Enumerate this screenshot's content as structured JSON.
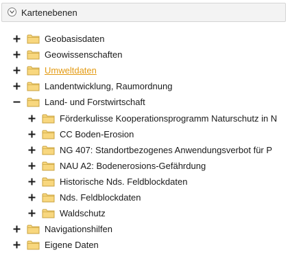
{
  "panel": {
    "title": "Kartenebenen",
    "collapse_icon": "chevron-down-icon"
  },
  "colors": {
    "folder_fill": "#f8d77e",
    "folder_stroke": "#c9a23d",
    "highlight_text": "#e39a12",
    "expander": "#1a1a1a"
  },
  "tree": [
    {
      "label": "Geobasisdaten",
      "level": 0,
      "expander": "plus",
      "highlighted": false
    },
    {
      "label": "Geowissenschaften",
      "level": 0,
      "expander": "plus",
      "highlighted": false
    },
    {
      "label": "Umweltdaten",
      "level": 0,
      "expander": "plus",
      "highlighted": true
    },
    {
      "label": "Landentwicklung, Raumordnung",
      "level": 0,
      "expander": "plus",
      "highlighted": false
    },
    {
      "label": "Land- und Forstwirtschaft",
      "level": 0,
      "expander": "minus",
      "highlighted": false
    },
    {
      "label": "Förderkulisse Kooperationsprogramm Naturschutz in N",
      "level": 1,
      "expander": "plus",
      "highlighted": false
    },
    {
      "label": "CC Boden-Erosion",
      "level": 1,
      "expander": "plus",
      "highlighted": false
    },
    {
      "label": "NG 407: Standortbezogenes Anwendungsverbot für P",
      "level": 1,
      "expander": "plus",
      "highlighted": false
    },
    {
      "label": "NAU A2: Bodenerosions-Gefährdung",
      "level": 1,
      "expander": "plus",
      "highlighted": false
    },
    {
      "label": "Historische Nds. Feldblockdaten",
      "level": 1,
      "expander": "plus",
      "highlighted": false
    },
    {
      "label": "Nds. Feldblockdaten",
      "level": 1,
      "expander": "plus",
      "highlighted": false
    },
    {
      "label": "Waldschutz",
      "level": 1,
      "expander": "plus",
      "highlighted": false
    },
    {
      "label": "Navigationshilfen",
      "level": 0,
      "expander": "plus",
      "highlighted": false
    },
    {
      "label": "Eigene Daten",
      "level": 0,
      "expander": "plus",
      "highlighted": false
    }
  ]
}
